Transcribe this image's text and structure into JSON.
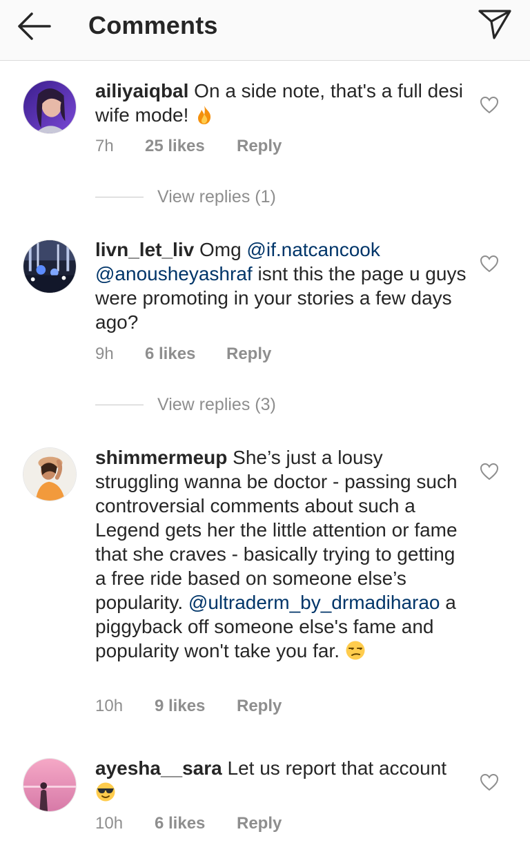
{
  "header": {
    "title": "Comments",
    "back_icon": "arrow-left-icon",
    "share_icon": "paper-plane-icon"
  },
  "comments": [
    {
      "username": "ailiyaiqbal",
      "text_1": " On a side note, that's a full desi wife mode! ",
      "emoji": "fire-emoji",
      "time": "7h",
      "likes": "25 likes",
      "reply": "Reply",
      "view_replies": "View replies (1)"
    },
    {
      "username": "livn_let_liv",
      "text_1": " Omg ",
      "mention_1": "@if.natcancook",
      "mention_2": "@anousheyashraf",
      "text_2": " isnt this the page u guys were promoting in your stories a few days ago?",
      "time": "9h",
      "likes": "6 likes",
      "reply": "Reply",
      "view_replies": "View replies (3)"
    },
    {
      "username": "shimmermeup",
      "text_1": " She’s just a lousy struggling wanna be doctor - passing such controversial comments about such a Legend gets her the little attention or fame that she craves - basically trying to getting a free ride based on someone else’s popularity. ",
      "mention_1": "@ultraderm_by_drmadiharao",
      "text_2": " a piggyback off someone else's fame and popularity won't take you far. ",
      "emoji": "unamused-face-emoji",
      "time": "10h",
      "likes": "9 likes",
      "reply": "Reply"
    },
    {
      "username": "ayesha__sara",
      "text_1": " Let us report that account ",
      "emoji": "sunglasses-face-emoji",
      "time": "10h",
      "likes": "6 likes",
      "reply": "Reply"
    }
  ],
  "colors": {
    "text": "#262626",
    "secondary": "#8e8e8e",
    "mention": "#003569",
    "header_bg": "#fafafa"
  }
}
